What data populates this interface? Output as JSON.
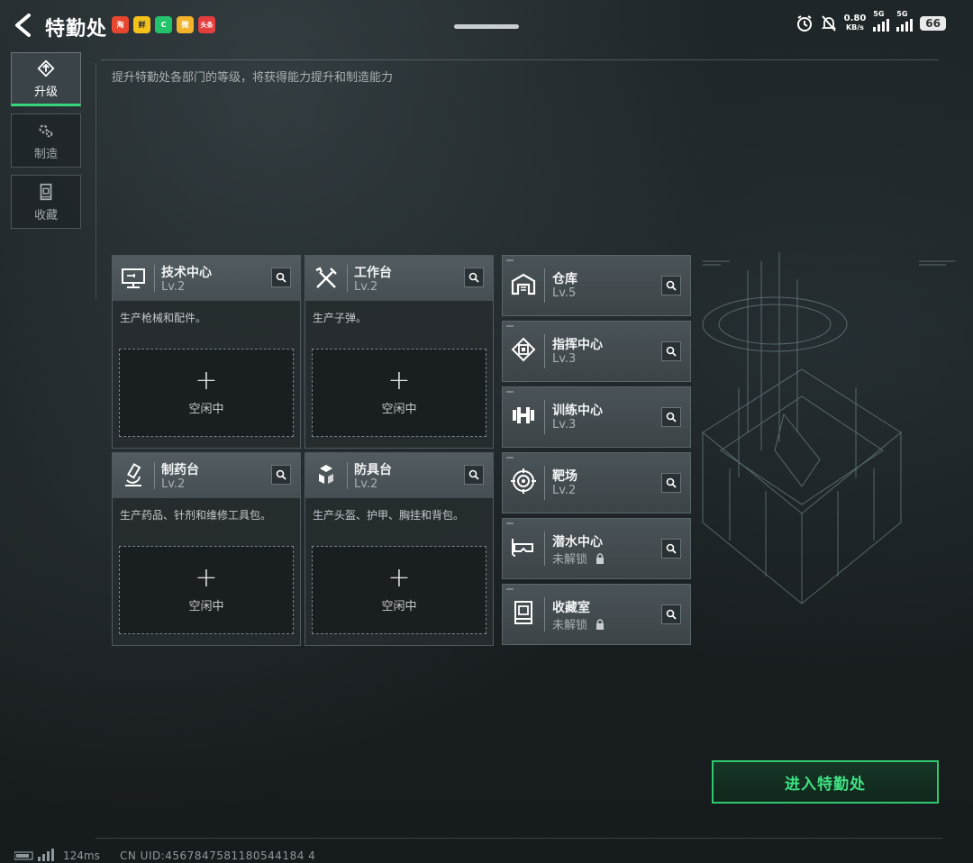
{
  "header": {
    "title": "特勤处",
    "apps": [
      {
        "name": "shop-app-icon",
        "label": "淘",
        "color": "#e9462f"
      },
      {
        "name": "taste-app-icon",
        "label": "鲜",
        "color": "#f5c21b"
      },
      {
        "name": "phone-app-icon",
        "label": "C",
        "color": "#23c36c"
      },
      {
        "name": "weibo-app-icon",
        "label": "微",
        "color": "#f3b32b"
      },
      {
        "name": "news-app-icon",
        "label": "头条",
        "color": "#e43e3e"
      }
    ],
    "net_speed": "0.80",
    "net_unit": "KB/s",
    "signal1_label": "5G",
    "signal2_label": "5G",
    "battery": "66"
  },
  "sidebar": {
    "tabs": [
      {
        "label": "升级",
        "icon": "upgrade-icon",
        "active": true
      },
      {
        "label": "制造",
        "icon": "gear-icon",
        "active": false
      },
      {
        "label": "收藏",
        "icon": "collection-icon",
        "active": false
      }
    ]
  },
  "main": {
    "subtitle": "提升特勤处各部门的等级，将获得能力提升和制造能力",
    "production": [
      {
        "name": "技术中心",
        "level": "Lv.2",
        "desc": "生产枪械和配件。",
        "plus": "+",
        "status": "空闲中",
        "icon": "tech-center-icon"
      },
      {
        "name": "工作台",
        "level": "Lv.2",
        "desc": "生产子弹。",
        "plus": "+",
        "status": "空闲中",
        "icon": "workbench-icon"
      },
      {
        "name": "制药台",
        "level": "Lv.2",
        "desc": "生产药品、针剂和维修工具包。",
        "plus": "+",
        "status": "空闲中",
        "icon": "microscope-icon"
      },
      {
        "name": "防具台",
        "level": "Lv.2",
        "desc": "生产头盔、护甲、胸挂和背包。",
        "plus": "+",
        "status": "空闲中",
        "icon": "armor-icon"
      }
    ],
    "facilities": [
      {
        "name": "仓库",
        "level": "Lv.5",
        "icon": "warehouse-icon",
        "locked": false
      },
      {
        "name": "指挥中心",
        "level": "Lv.3",
        "icon": "command-chip-icon",
        "locked": false
      },
      {
        "name": "训练中心",
        "level": "Lv.3",
        "icon": "dumbbell-icon",
        "locked": false
      },
      {
        "name": "靶场",
        "level": "Lv.2",
        "icon": "target-icon",
        "locked": false
      },
      {
        "name": "潜水中心",
        "level": "未解锁",
        "icon": "diving-mask-icon",
        "locked": true
      },
      {
        "name": "收藏室",
        "level": "未解锁",
        "icon": "collection-room-icon",
        "locked": true
      }
    ],
    "enter_button": "进入特勤处"
  },
  "footer": {
    "ping": "124ms",
    "uid": "CN UID:4567847581180544184 4"
  },
  "colors": {
    "accent": "#2fc86f",
    "background": "#1a2023",
    "card_header": "#4a5357"
  }
}
